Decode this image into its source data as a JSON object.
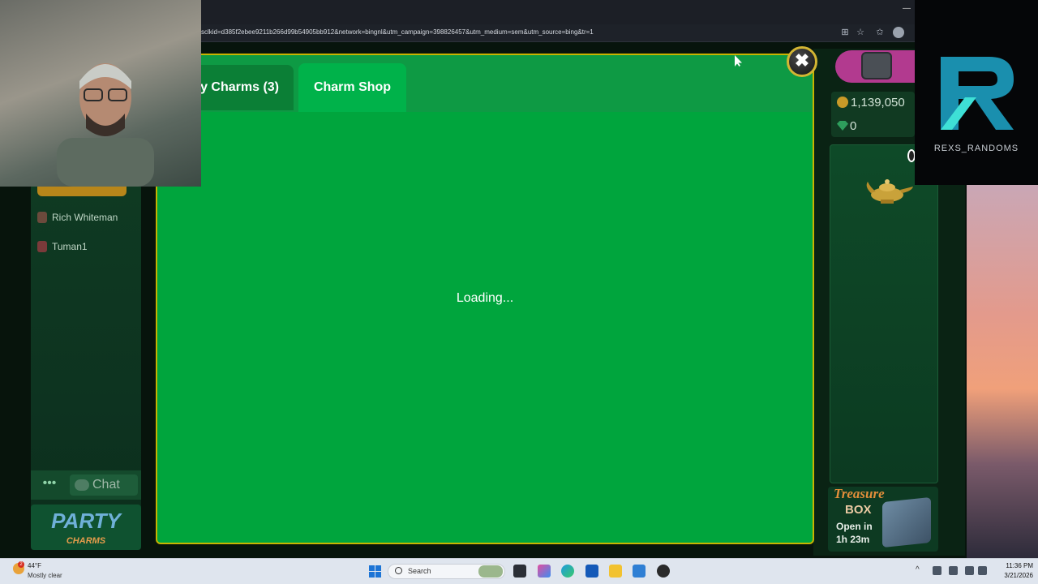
{
  "browser": {
    "url": "sclkid=d385f2ebee9211b266d99b54905bb912&network=bingnl&utm_campaign=398826457&utm_medium=sem&utm_source=bing&tr=1",
    "toolbar_icons": [
      "extensions-icon",
      "favorite-star-icon",
      "favorites-icon",
      "profile-icon"
    ]
  },
  "game": {
    "players": [
      "Rich Whiteman",
      "Tuman1"
    ],
    "chat_label": "Chat",
    "more_label": "•••",
    "logo": {
      "line1": "PARTY",
      "line2": "CHARMS"
    },
    "coins": "1,139,050",
    "gems": "0",
    "treasure": {
      "title": "Treasure",
      "box": "BOX",
      "timer_line1": "Open in",
      "timer_line2": "1h 23m"
    }
  },
  "modal": {
    "tabs": [
      {
        "label": "My Charms (3)",
        "active": false
      },
      {
        "label": "Charm Shop",
        "active": true
      }
    ],
    "status": "Loading...",
    "close_glyph": "✖"
  },
  "stream": {
    "channel_name": "REXS_RANDOMS"
  },
  "taskbar": {
    "weather_badge": "2",
    "weather_temp": "44°F",
    "weather_desc": "Mostly clear",
    "search_label": "Search",
    "time": "11:36 PM",
    "date": "3/21/2026",
    "tray_chevron": "^"
  },
  "colors": {
    "modal_green": "#00a53d",
    "modal_border": "#c8b400",
    "active_tab": "#00b24a",
    "inactive_tab": "#0b7f36"
  }
}
